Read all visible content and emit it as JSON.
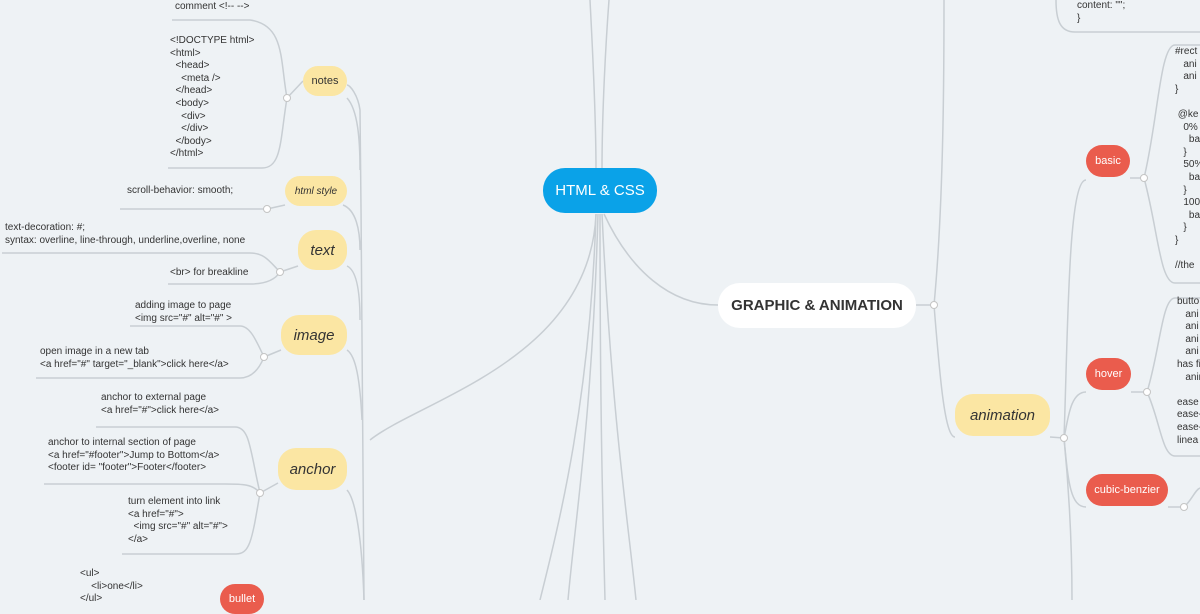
{
  "root": {
    "label": "HTML & CSS"
  },
  "left_branch": {
    "topics": [
      {
        "label": "notes",
        "notes": [
          "comment <!-- -->",
          "<!DOCTYPE html>\n<html>\n  <head>\n    <meta />\n  </head>\n  <body>\n    <div>\n    </div>\n  </body>\n</html>"
        ]
      },
      {
        "label": "html style",
        "notes": [
          "scroll-behavior: smooth;"
        ]
      },
      {
        "label": "text",
        "notes": [
          "text-decoration: #;\nsyntax: overline, line-through, underline,overline, none",
          "<br> for breakline"
        ]
      },
      {
        "label": "image",
        "notes": [
          "adding image to page\n<img src=\"#\" alt=\"#\" >",
          "open image in a new tab\n<a href=\"#\" target=\"_blank\">click here</a>"
        ]
      },
      {
        "label": "anchor",
        "notes": [
          "anchor to external page\n<a href=\"#\">click here</a>",
          "anchor to internal section of page\n<a href=\"#footer\">Jump to Bottom</a>\n<footer id= \"footer\">Footer</footer>",
          "turn element into link\n<a href=\"#\">\n  <img src=\"#\" alt=\"#\">\n</a>"
        ]
      },
      {
        "label": "bullet",
        "notes": [
          "<ul>\n    <li>one</li>\n</ul>"
        ]
      }
    ]
  },
  "right_branch": {
    "label": "GRAPHIC & ANIMATION",
    "top_note": "content: \"\";\n}",
    "topic": {
      "label": "animation",
      "subtopics": [
        {
          "label": "basic",
          "note": "#rect\n   ani\n   ani\n}\n\n @ke\n   0%\n     ba\n   }\n   50%\n     ba\n   }\n   100\n     ba\n   }\n}\n\n//the"
        },
        {
          "label": "hover",
          "note": "butto\n   ani\n   ani\n   ani\n   ani\nhas fi\n   anim\n\nease\nease-\nease-\nlinea"
        },
        {
          "label": "cubic-benzier"
        }
      ]
    }
  },
  "colors": {
    "root": "#0aa2e8",
    "main": "#ffffff",
    "topic_yellow": "#fbe6a3",
    "topic_red": "#ea5c4d",
    "line": "#c8ced3"
  }
}
